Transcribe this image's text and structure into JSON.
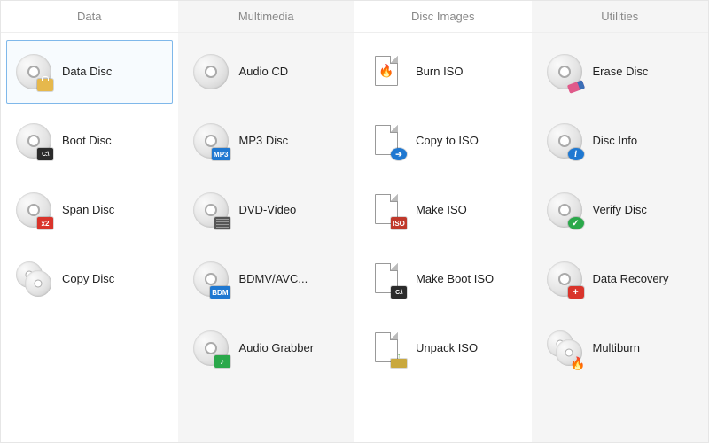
{
  "columns": [
    {
      "header": "Data",
      "items": [
        {
          "label": "Data Disc",
          "icon": "disc-lock",
          "selected": true
        },
        {
          "label": "Boot Disc",
          "icon": "disc-prompt"
        },
        {
          "label": "Span Disc",
          "icon": "disc-x2"
        },
        {
          "label": "Copy Disc",
          "icon": "disc-double"
        }
      ]
    },
    {
      "header": "Multimedia",
      "items": [
        {
          "label": "Audio CD",
          "icon": "disc"
        },
        {
          "label": "MP3 Disc",
          "icon": "disc-mp3"
        },
        {
          "label": "DVD-Video",
          "icon": "disc-film"
        },
        {
          "label": "BDMV/AVC...",
          "icon": "disc-bdm"
        },
        {
          "label": "Audio Grabber",
          "icon": "disc-note"
        }
      ]
    },
    {
      "header": "Disc Images",
      "items": [
        {
          "label": "Burn ISO",
          "icon": "page-flame"
        },
        {
          "label": "Copy to ISO",
          "icon": "page-arrow"
        },
        {
          "label": "Make ISO",
          "icon": "page-iso"
        },
        {
          "label": "Make Boot ISO",
          "icon": "page-prompt"
        },
        {
          "label": "Unpack ISO",
          "icon": "page-unpack"
        }
      ]
    },
    {
      "header": "Utilities",
      "items": [
        {
          "label": "Erase Disc",
          "icon": "disc-eraser"
        },
        {
          "label": "Disc Info",
          "icon": "disc-info"
        },
        {
          "label": "Verify Disc",
          "icon": "disc-check"
        },
        {
          "label": "Data Recovery",
          "icon": "disc-med"
        },
        {
          "label": "Multiburn",
          "icon": "disc-double-flame"
        }
      ]
    }
  ]
}
